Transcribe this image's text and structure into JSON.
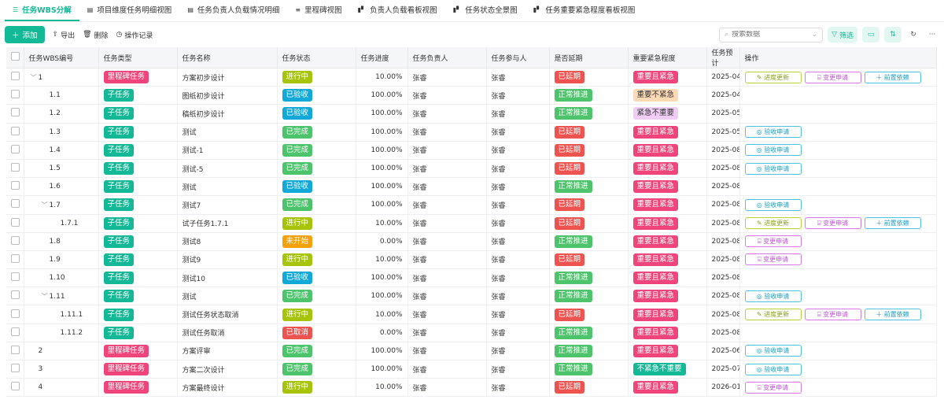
{
  "tabs": [
    {
      "label": "任务WBS分解",
      "icon": "tree-icon",
      "active": true
    },
    {
      "label": "项目维度任务明细视图",
      "icon": "table-icon"
    },
    {
      "label": "任务负责人负载情况明细",
      "icon": "table-icon"
    },
    {
      "label": "里程碑视图",
      "icon": "gantt-icon"
    },
    {
      "label": "负责人负载看板视图",
      "icon": "kanban-icon"
    },
    {
      "label": "任务状态全景图",
      "icon": "kanban-icon"
    },
    {
      "label": "任务重要紧急程度看板视图",
      "icon": "kanban-icon"
    }
  ],
  "toolbar": {
    "add": "添加",
    "export": "导出",
    "delete": "删除",
    "log": "操作记录",
    "search_placeholder": "搜索数据",
    "filter": "筛选"
  },
  "columns": [
    "任务WBS编号",
    "任务类型",
    "任务名称",
    "任务状态",
    "任务进度",
    "任务负责人",
    "任务参与人",
    "是否延期",
    "重要紧急程度",
    "任务预计",
    "操作"
  ],
  "colors": {
    "里程碑任务": "#f0457a",
    "子任务": "#13b896",
    "进行中": "#a8c40a",
    "已验收": "#12a9d8",
    "已完成": "#4dc46c",
    "未开始": "#f5a20a",
    "已取消": "#ef5350",
    "已延期": "#ef5350",
    "正常推进": "#4dc46c",
    "重要且紧急": "#f0457a",
    "重要不紧急": "#fdd9b5",
    "紧急不重要": "#f0cdf5",
    "不紧急不重要": "#13b896"
  },
  "ops": {
    "progress": "进度更新",
    "change": "变更申请",
    "predep": "前置依赖",
    "accept": "验收申请"
  },
  "rows": [
    {
      "wbs": "1",
      "level": 0,
      "expand": true,
      "type": "里程碑任务",
      "name": "方案初步设计",
      "status": "进行中",
      "progress": "10.00%",
      "owner": "张睿",
      "part": "张睿",
      "delay": "已延期",
      "urg": "重要且紧急",
      "date": "2025-04-",
      "ops": [
        "progress",
        "change",
        "predep"
      ]
    },
    {
      "wbs": "1.1",
      "level": 1,
      "type": "子任务",
      "name": "图纸初步设计",
      "status": "已验收",
      "progress": "100.00%",
      "owner": "张睿",
      "part": "张睿",
      "delay": "正常推进",
      "urg": "重要不紧急",
      "date": "2025-04-",
      "ops": []
    },
    {
      "wbs": "1.2",
      "level": 1,
      "type": "子任务",
      "name": "稿纸初步设计",
      "status": "已验收",
      "progress": "100.00%",
      "owner": "张睿",
      "part": "张睿",
      "delay": "正常推进",
      "urg": "紧急不重要",
      "date": "2025-05-",
      "ops": []
    },
    {
      "wbs": "1.3",
      "level": 1,
      "type": "子任务",
      "name": "测试",
      "status": "已完成",
      "progress": "100.00%",
      "owner": "张睿",
      "part": "张睿",
      "delay": "已延期",
      "urg": "重要且紧急",
      "date": "2025-05-",
      "ops": [
        "accept"
      ]
    },
    {
      "wbs": "1.4",
      "level": 1,
      "type": "子任务",
      "name": "测试-1",
      "status": "已完成",
      "progress": "100.00%",
      "owner": "张睿",
      "part": "张睿",
      "delay": "已延期",
      "urg": "重要且紧急",
      "date": "2025-08-",
      "ops": [
        "accept"
      ]
    },
    {
      "wbs": "1.5",
      "level": 1,
      "type": "子任务",
      "name": "测试-5",
      "status": "已完成",
      "progress": "100.00%",
      "owner": "张睿",
      "part": "张睿",
      "delay": "已延期",
      "urg": "重要且紧急",
      "date": "2025-08-",
      "ops": [
        "accept"
      ]
    },
    {
      "wbs": "1.6",
      "level": 1,
      "type": "子任务",
      "name": "测试",
      "status": "已验收",
      "progress": "100.00%",
      "owner": "张睿",
      "part": "张睿",
      "delay": "正常推进",
      "urg": "重要且紧急",
      "date": "2025-08-",
      "ops": []
    },
    {
      "wbs": "1.7",
      "level": 1,
      "expand": true,
      "type": "子任务",
      "name": "测试7",
      "status": "已完成",
      "progress": "100.00%",
      "owner": "张睿",
      "part": "张睿",
      "delay": "已延期",
      "urg": "重要且紧急",
      "date": "2025-08-",
      "ops": [
        "accept"
      ]
    },
    {
      "wbs": "1.7.1",
      "level": 2,
      "type": "子任务",
      "name": "试子任务1.7.1",
      "status": "进行中",
      "progress": "10.00%",
      "owner": "张睿",
      "part": "张睿",
      "delay": "已延期",
      "urg": "重要且紧急",
      "date": "2025-08-",
      "ops": [
        "progress",
        "change",
        "predep"
      ]
    },
    {
      "wbs": "1.8",
      "level": 1,
      "type": "子任务",
      "name": "测试8",
      "status": "未开始",
      "progress": "0.00%",
      "owner": "张睿",
      "part": "张睿",
      "delay": "正常推进",
      "urg": "重要且紧急",
      "date": "2025-08-",
      "ops": [
        "change"
      ]
    },
    {
      "wbs": "1.9",
      "level": 1,
      "type": "子任务",
      "name": "测试9",
      "status": "进行中",
      "progress": "10.00%",
      "owner": "张睿",
      "part": "张睿",
      "delay": "已延期",
      "urg": "重要且紧急",
      "date": "2025-08-",
      "ops": [
        "change"
      ]
    },
    {
      "wbs": "1.10",
      "level": 1,
      "type": "子任务",
      "name": "测试10",
      "status": "已验收",
      "progress": "100.00%",
      "owner": "张睿",
      "part": "张睿",
      "delay": "正常推进",
      "urg": "重要且紧急",
      "date": "2025-08-",
      "ops": []
    },
    {
      "wbs": "1.11",
      "level": 1,
      "expand": true,
      "type": "子任务",
      "name": "测试",
      "status": "已完成",
      "progress": "100.00%",
      "owner": "张睿",
      "part": "张睿",
      "delay": "正常推进",
      "urg": "重要且紧急",
      "date": "2025-08-",
      "ops": [
        "accept"
      ]
    },
    {
      "wbs": "1.11.1",
      "level": 2,
      "type": "子任务",
      "name": "测试任务状态取消",
      "status": "进行中",
      "progress": "10.00%",
      "owner": "张睿",
      "part": "张睿",
      "delay": "已延期",
      "urg": "重要且紧急",
      "date": "2025-08-",
      "ops": [
        "progress",
        "change",
        "predep"
      ]
    },
    {
      "wbs": "1.11.2",
      "level": 2,
      "type": "子任务",
      "name": "测试任务取消",
      "status": "已取消",
      "progress": "0.00%",
      "owner": "张睿",
      "part": "张睿",
      "delay": "正常推进",
      "urg": "重要且紧急",
      "date": "2025-08-",
      "ops": []
    },
    {
      "wbs": "2",
      "level": 0,
      "type": "里程碑任务",
      "name": "方案评审",
      "status": "已完成",
      "progress": "100.00%",
      "owner": "张睿",
      "part": "张睿",
      "delay": "正常推进",
      "urg": "重要且紧急",
      "date": "2025-06-",
      "ops": [
        "accept"
      ]
    },
    {
      "wbs": "3",
      "level": 0,
      "type": "里程碑任务",
      "name": "方案二次设计",
      "status": "已完成",
      "progress": "100.00%",
      "owner": "张睿",
      "part": "张睿",
      "delay": "正常推进",
      "urg": "不紧急不重要",
      "date": "2025-07-",
      "ops": [
        "accept"
      ]
    },
    {
      "wbs": "4",
      "level": 0,
      "type": "里程碑任务",
      "name": "方案最终设计",
      "status": "进行中",
      "progress": "10.00%",
      "owner": "张睿",
      "part": "张睿",
      "delay": "已延期",
      "urg": "重要且紧急",
      "date": "2026-01-",
      "ops": [
        "change"
      ]
    }
  ]
}
